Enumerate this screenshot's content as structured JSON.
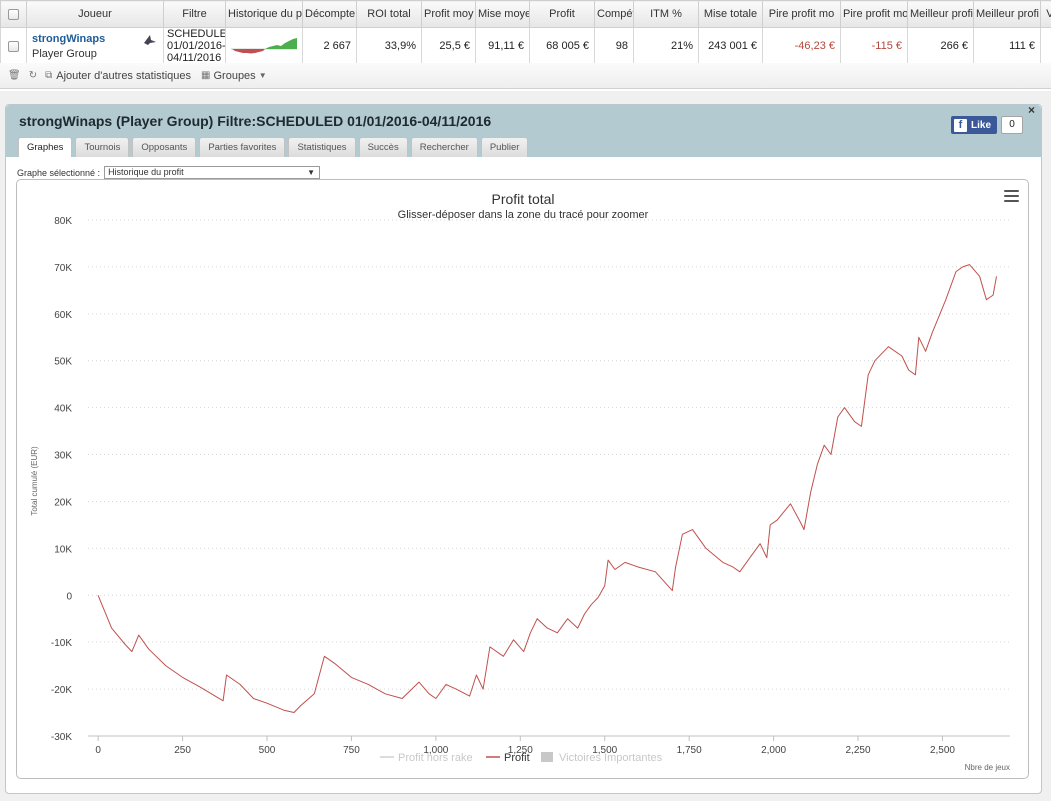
{
  "stats_table": {
    "columns": [
      "Joueur",
      "Filtre",
      "Historique du p",
      "Décompte",
      "ROI total",
      "Profit moy",
      "Mise moye",
      "Profit",
      "Compét",
      "ITM %",
      "Mise totale",
      "Pire profit mo",
      "Pire profit mo",
      "Meilleur profi",
      "Meilleur profi",
      "Vi"
    ],
    "row": {
      "player_name": "strongWinaps",
      "player_type": "Player Group",
      "filter_lines": [
        "SCHEDULED",
        "01/01/2016-",
        "04/11/2016"
      ],
      "decompte": "2 667",
      "roi_total": "33,9%",
      "profit_moy": "25,5 €",
      "mise_moy": "91,11 €",
      "profit": "68 005 €",
      "competitions": "98",
      "itm": "21%",
      "mise_totale": "243 001 €",
      "pire_profit_1": "-46,23 €",
      "pire_profit_2": "-115 €",
      "meilleur_profit_1": "266 €",
      "meilleur_profit_2": "111 €"
    }
  },
  "toolbar": {
    "add_stats": "Ajouter d'autres statistiques",
    "groups": "Groupes"
  },
  "panel": {
    "title": "strongWinaps (Player Group) Filtre:",
    "title_filter": "SCHEDULED 01/01/2016-04/11/2016",
    "fb_like": "Like",
    "fb_count": "0",
    "close": "×",
    "tabs": [
      "Graphes",
      "Tournois",
      "Opposants",
      "Parties favorites",
      "Statistiques",
      "Succès",
      "Rechercher",
      "Publier"
    ],
    "graph_select_label": "Graphe sélectionné :",
    "graph_select_value": "Historique du profit"
  },
  "colors": {
    "profit_line": "#c0504d",
    "hors_rake_line": "#d0d0d0",
    "header_bg": "#b3cad0",
    "player_link": "#1f5c99"
  },
  "chart_data": {
    "type": "line",
    "title": "Profit total",
    "subtitle": "Glisser-déposer dans la zone du tracé pour zoomer",
    "xlabel": "Nbre de jeux",
    "ylabel": "Total cumulé (EUR)",
    "xlim": [
      -30,
      2700
    ],
    "ylim": [
      -30000,
      80000
    ],
    "x_ticks": [
      "0",
      "250",
      "500",
      "750",
      "1,000",
      "1,250",
      "1,500",
      "1,750",
      "2,000",
      "2,250",
      "2,500"
    ],
    "x_tick_values": [
      0,
      250,
      500,
      750,
      1000,
      1250,
      1500,
      1750,
      2000,
      2250,
      2500
    ],
    "y_ticks": [
      "-30K",
      "-20K",
      "-10K",
      "0",
      "10K",
      "20K",
      "30K",
      "40K",
      "50K",
      "60K",
      "70K",
      "80K"
    ],
    "y_tick_values": [
      -30000,
      -20000,
      -10000,
      0,
      10000,
      20000,
      30000,
      40000,
      50000,
      60000,
      70000,
      80000
    ],
    "legend": [
      {
        "name": "Profit hors rake",
        "style": "line",
        "color": "#d0d0d0"
      },
      {
        "name": "Profit",
        "style": "line",
        "color": "#c0504d"
      },
      {
        "name": "Victoires Importantes",
        "style": "box",
        "color": "#c8c8c8"
      }
    ],
    "series": [
      {
        "name": "Profit",
        "x": [
          0,
          40,
          80,
          100,
          120,
          150,
          200,
          250,
          300,
          370,
          380,
          420,
          460,
          500,
          550,
          580,
          600,
          640,
          670,
          700,
          750,
          800,
          850,
          900,
          950,
          980,
          1000,
          1030,
          1060,
          1100,
          1120,
          1140,
          1160,
          1200,
          1230,
          1260,
          1280,
          1300,
          1330,
          1360,
          1390,
          1420,
          1440,
          1460,
          1480,
          1500,
          1510,
          1530,
          1560,
          1600,
          1650,
          1700,
          1710,
          1730,
          1760,
          1800,
          1850,
          1880,
          1900,
          1930,
          1960,
          1980,
          1990,
          2010,
          2050,
          2080,
          2090,
          2110,
          2130,
          2150,
          2170,
          2190,
          2210,
          2240,
          2260,
          2280,
          2300,
          2340,
          2380,
          2400,
          2420,
          2430,
          2450,
          2470,
          2510,
          2540,
          2560,
          2580,
          2610,
          2630,
          2650,
          2660
        ],
        "y": [
          0,
          -7000,
          -10500,
          -12000,
          -8500,
          -11500,
          -15000,
          -17500,
          -19500,
          -22500,
          -17000,
          -19000,
          -22000,
          -23000,
          -24500,
          -25000,
          -23500,
          -21000,
          -13000,
          -14500,
          -17500,
          -19000,
          -21000,
          -22000,
          -18500,
          -21000,
          -22000,
          -19000,
          -20000,
          -21500,
          -17000,
          -20000,
          -11000,
          -13000,
          -9500,
          -12000,
          -8000,
          -5000,
          -7000,
          -8000,
          -5000,
          -7000,
          -4000,
          -2000,
          -500,
          2000,
          7500,
          5500,
          7000,
          6000,
          5000,
          1000,
          6000,
          13000,
          14000,
          10000,
          7000,
          6000,
          5000,
          8000,
          11000,
          8000,
          15000,
          16000,
          19500,
          15500,
          14000,
          22000,
          28000,
          32000,
          30000,
          38000,
          40000,
          37000,
          36000,
          47000,
          50000,
          53000,
          51000,
          48000,
          47000,
          55000,
          52000,
          56000,
          63000,
          69000,
          70000,
          70500,
          68000,
          63000,
          64000,
          68000
        ]
      }
    ]
  }
}
